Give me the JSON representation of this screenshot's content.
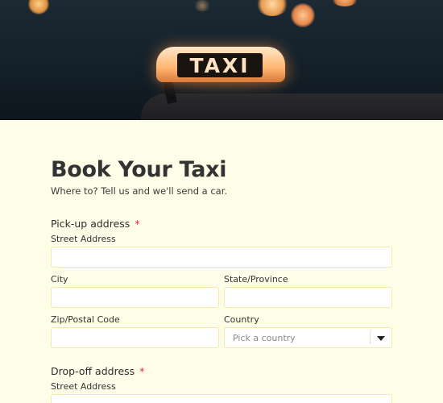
{
  "hero": {
    "sign_text": "TAXI"
  },
  "form": {
    "title": "Book Your Taxi",
    "subtitle": "Where to? Tell us and we'll send a car.",
    "pickup": {
      "label": "Pick-up address",
      "required_mark": "*",
      "street_label": "Street Address",
      "city_label": "City",
      "state_label": "State/Province",
      "zip_label": "Zip/Postal Code",
      "country_label": "Country",
      "country_placeholder": "Pick a country"
    },
    "dropoff": {
      "label": "Drop-off address",
      "required_mark": "*",
      "street_label": "Street Address"
    }
  },
  "colors": {
    "background": "#fefde7",
    "input_border": "#f6e9a6",
    "required": "#e0244a"
  },
  "icons": {
    "country_select": "chevron-down-icon"
  }
}
